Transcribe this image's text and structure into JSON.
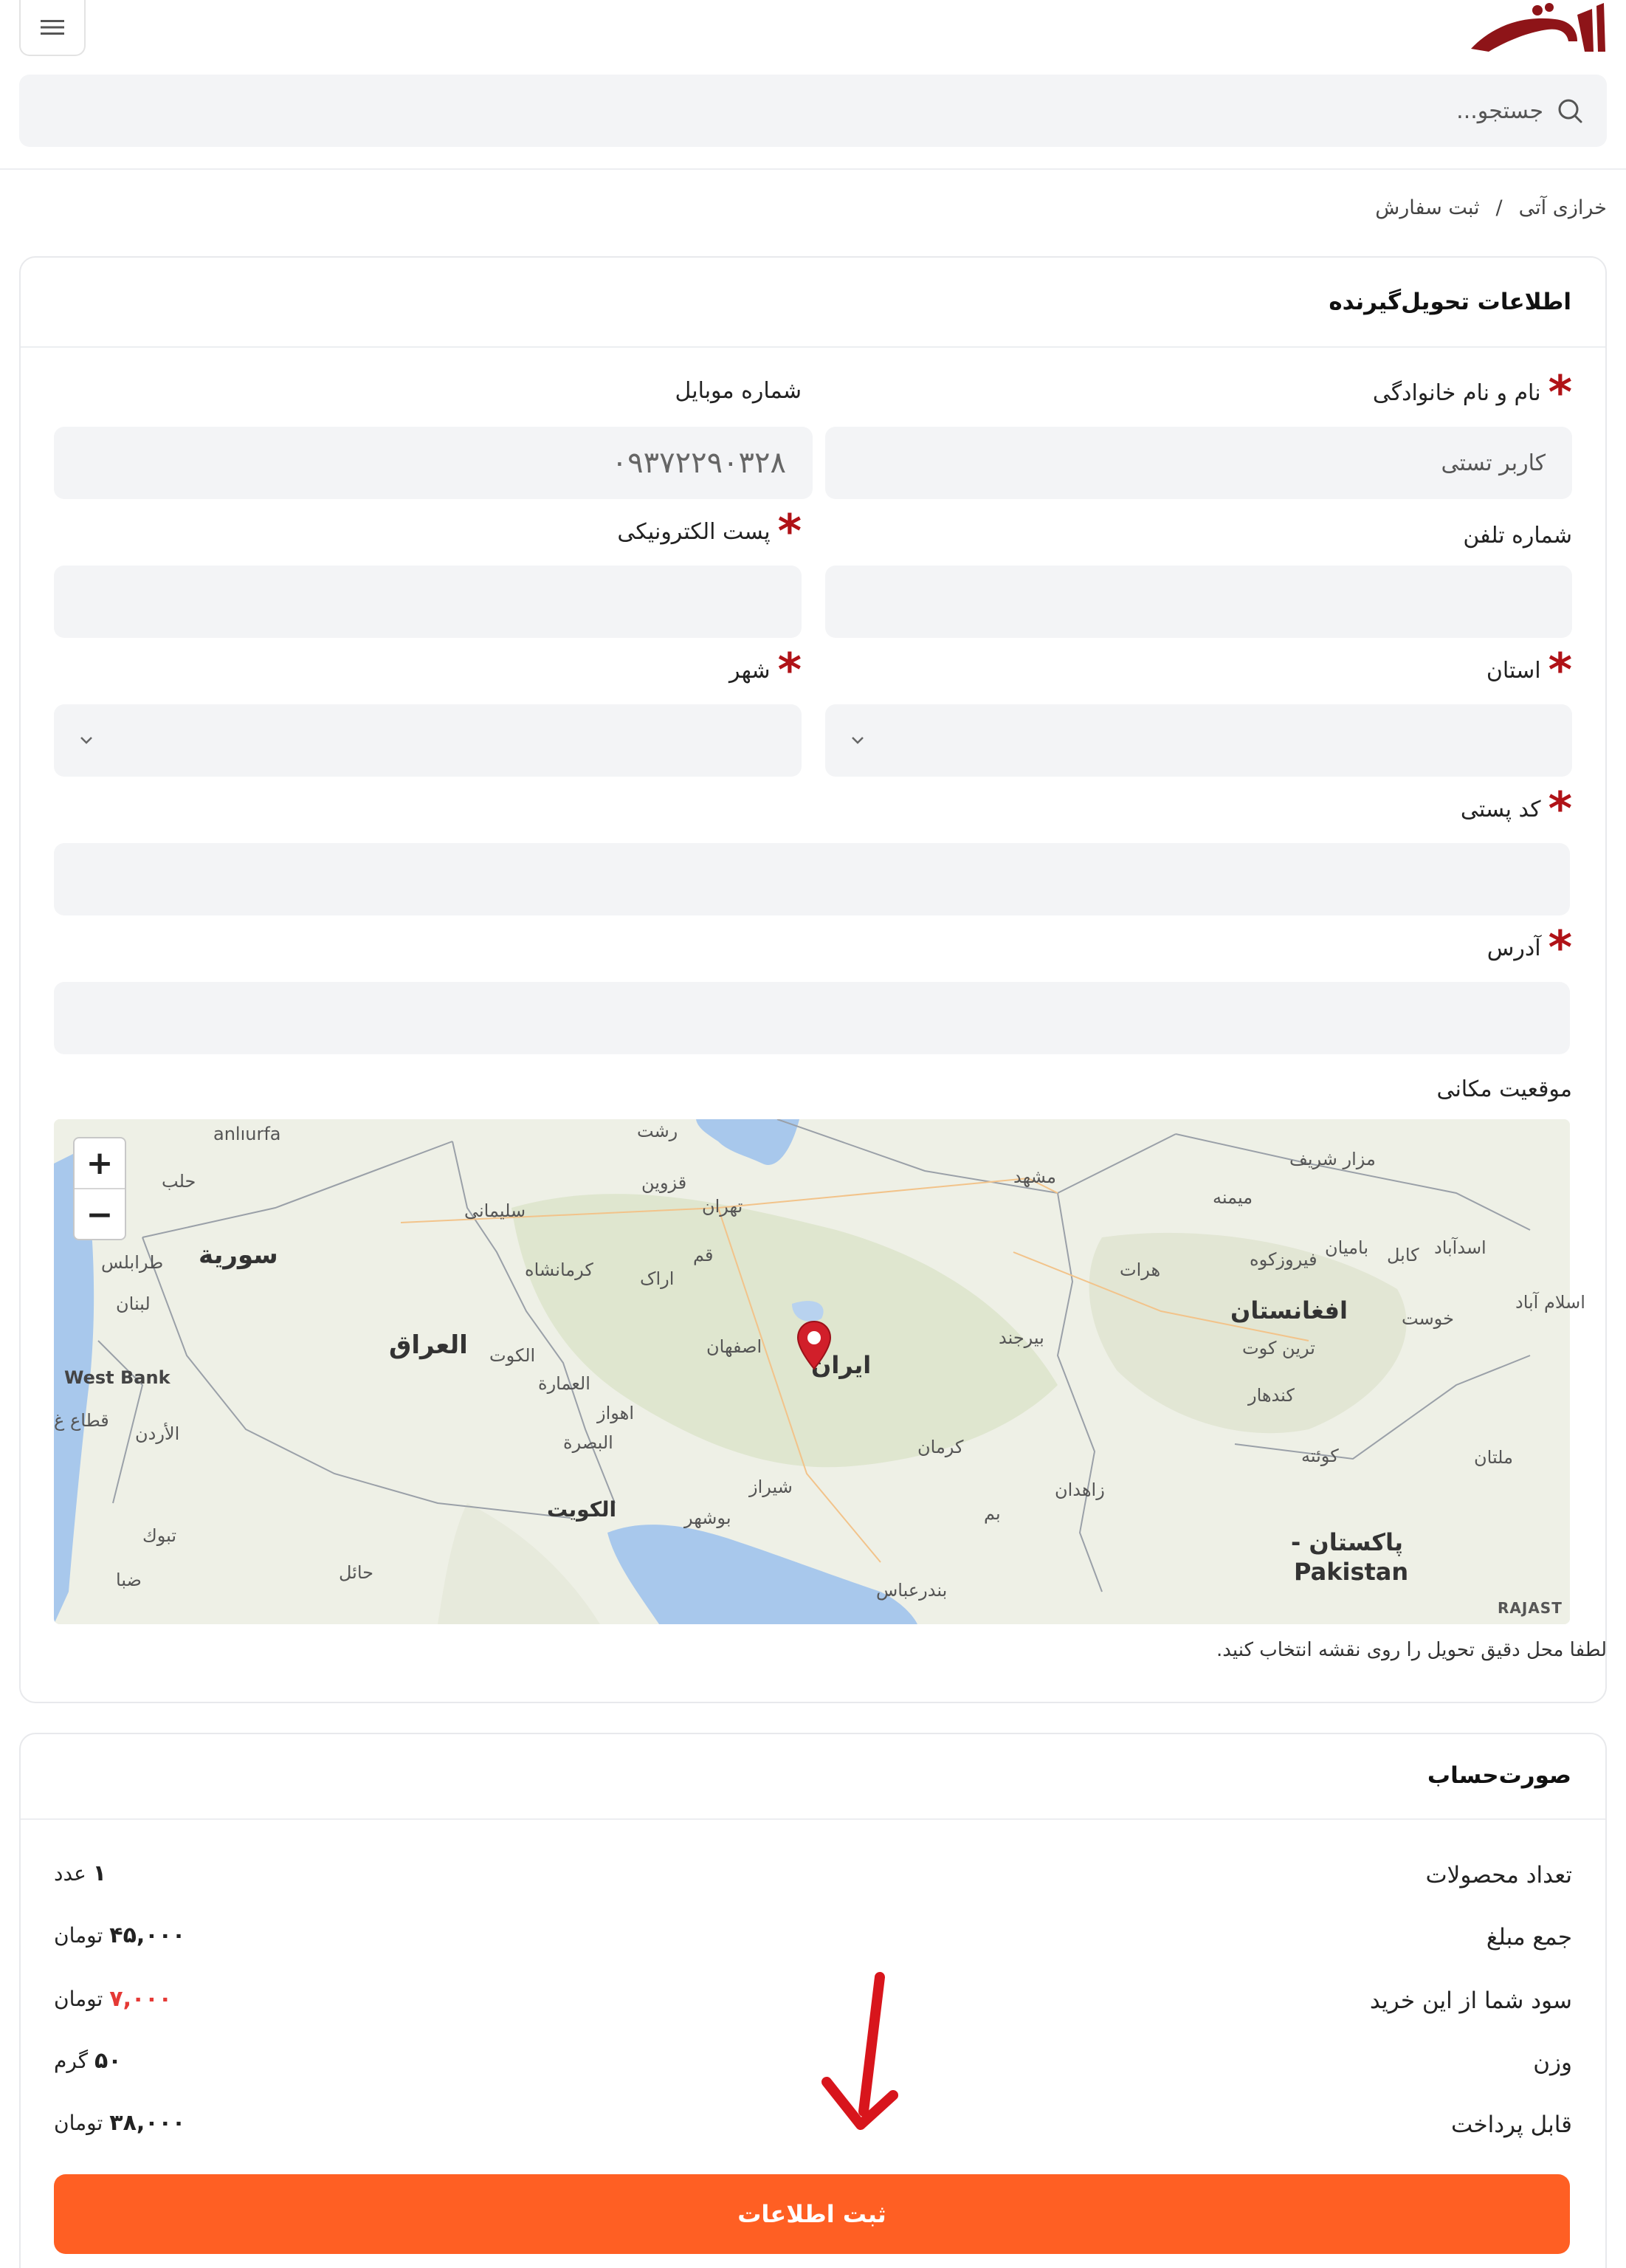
{
  "header": {
    "logo_alt": "آنتی",
    "search_placeholder": "جستجو..."
  },
  "breadcrumb": {
    "home": "خرازی آتی",
    "separator": "/",
    "current": "ثبت سفارش"
  },
  "recipient": {
    "title": "اطلاعات تحویل‌گیرنده",
    "fields": {
      "full_name": {
        "label": "نام و نام خانوادگی",
        "value": "کاربر تستی"
      },
      "mobile": {
        "label": "شماره موبایل",
        "value": "۰۹۳۷۲۲۹۰۳۲۸"
      },
      "phone": {
        "label": "شماره تلفن",
        "value": ""
      },
      "email": {
        "label": "پست الکترونیکی",
        "value": ""
      },
      "province": {
        "label": "استان",
        "value": ""
      },
      "city": {
        "label": "شهر",
        "value": ""
      },
      "postal_code": {
        "label": "کد پستی",
        "value": ""
      },
      "address": {
        "label": "آدرس",
        "value": ""
      }
    },
    "location_label": "موقعیت مکانی",
    "map": {
      "zoom_in": "+",
      "zoom_out": "−",
      "attribution": "RAJAST",
      "labels": {
        "iran": "ایران",
        "iraq": "العراق",
        "syria": "سورية",
        "afghanistan": "افغانستان",
        "pakistan": "پاکستان -",
        "pakistan_en": "Pakistan",
        "kuwait": "الكويت",
        "jordan": "الأردن",
        "westbank": "West Bank",
        "gaza": "قطاع غ",
        "lebanon": "لبنان",
        "tripoli": "طرابلس",
        "aleppo": "حلب",
        "sanliurfa": "anlıurfa",
        "tehran": "تهران",
        "mashhad": "مشهد",
        "isfahan": "اصفهان",
        "shiraz": "شیراز",
        "ahvaz": "اهواز",
        "kermanshah": "کرمانشاه",
        "qazvin": "قزوین",
        "rasht": "رشت",
        "qom": "قم",
        "arak": "اراک",
        "kerman": "کرمان",
        "zahedan": "زاهدان",
        "birjand": "بیرجند",
        "bushehr": "بوشهر",
        "bandar_abbas": "بندرعباس",
        "bam": "بم",
        "herat": "هرات",
        "kabul": "کابل",
        "kandahar": "کندهار",
        "quetta": "کوئته",
        "multan": "ملتان",
        "basra": "البصرة",
        "amara": "العمارة",
        "kut": "الكوت",
        "sulaymaniyah": "سلیمانی",
        "tabuk": "تبوك",
        "hail": "حائل",
        "duba": "ضبا",
        "bamyan": "باميان",
        "mazar": "مزار شریف",
        "maymana": "میمنه",
        "firozkoh": "فیروزکوه",
        "tarinkot": "ترین کوت",
        "khost": "خوست",
        "islamabad_part": "اسلام آباد",
        "asadabad": "اسدآباد"
      }
    },
    "map_hint": "لطفا محل دقیق تحویل را روی نقشه انتخاب کنید."
  },
  "invoice": {
    "title": "صورت‌حساب",
    "rows": [
      {
        "label": "تعداد محصولات",
        "value": "۱",
        "unit": "عدد"
      },
      {
        "label": "جمع مبلغ",
        "value": "۴۵,۰۰۰",
        "unit": "تومان"
      },
      {
        "label": "سود شما از این خرید",
        "value": "۷,۰۰۰",
        "unit": "تومان"
      },
      {
        "label": "وزن",
        "value": "۵۰",
        "unit": "گرم"
      },
      {
        "label": "قابل پرداخت",
        "value": "۳۸,۰۰۰",
        "unit": "تومان"
      }
    ],
    "submit_label": "ثبت اطلاعات"
  },
  "colors": {
    "accent": "#ff5f23",
    "required": "#b01217",
    "profit": "#e53935"
  }
}
